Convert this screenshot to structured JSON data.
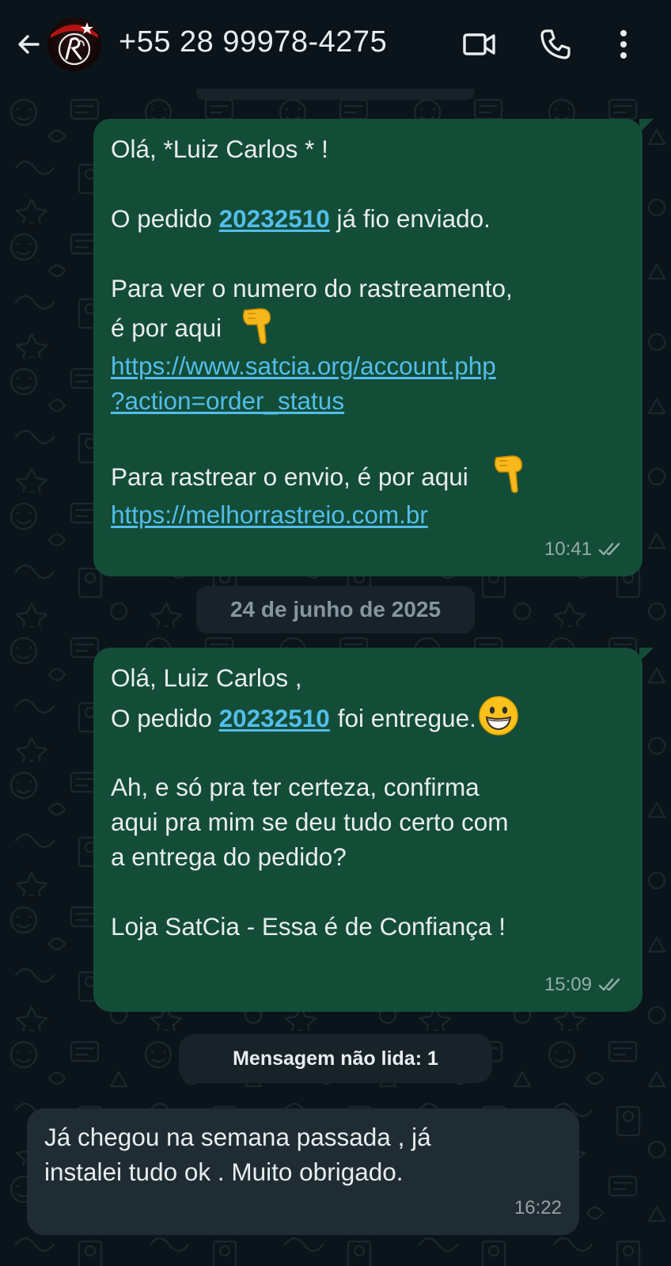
{
  "header": {
    "contact": "+55 28 99978-4275",
    "icons": [
      "back-arrow-icon",
      "video-call-icon",
      "voice-call-icon",
      "more-options-icon"
    ]
  },
  "messages": [
    {
      "direction": "outgoing",
      "lines": {
        "greeting": "Olá, *Luiz Carlos * !",
        "order_prefix": "O pedido",
        "order_number": "20232510",
        "order_suffix": "já fio enviado.",
        "tracking_line1": "Para ver o numero do rastreamento,",
        "tracking_line2": "é por aqui",
        "link1_part1": "https://www.satcia.org/account.php",
        "link1_part2": "?action=order_status",
        "ship_line": "Para rastrear o envio, é por aqui",
        "link2": "https://melhorrastreio.com.br"
      },
      "time": "10:41",
      "status": "read-double-check"
    },
    {
      "direction": "outgoing",
      "lines": {
        "greeting": "Olá, Luiz Carlos ,",
        "order_prefix": "O pedido",
        "order_number": "20232510",
        "order_suffix": "foi entregue.",
        "confirm_line1": "Ah, e só pra ter certeza, confirma",
        "confirm_line2": "aqui pra mim se deu tudo certo com",
        "confirm_line3": "a entrega do pedido?",
        "signature": "Loja SatCia - Essa é de Confiança !"
      },
      "time": "15:09",
      "status": "read-double-check"
    },
    {
      "direction": "incoming",
      "lines": {
        "line1": "Já chegou na semana passada , já",
        "line2": "instalei tudo ok . Muito obrigado."
      },
      "time": "16:22"
    }
  ],
  "date_separator": "24 de junho de 2025",
  "unread_banner": "Mensagem não lida: 1",
  "colors": {
    "background": "#0b141a",
    "outgoing_bubble": "#134d37",
    "incoming_bubble": "#202c33",
    "link": "#53bdeb",
    "pill": "#182229"
  }
}
